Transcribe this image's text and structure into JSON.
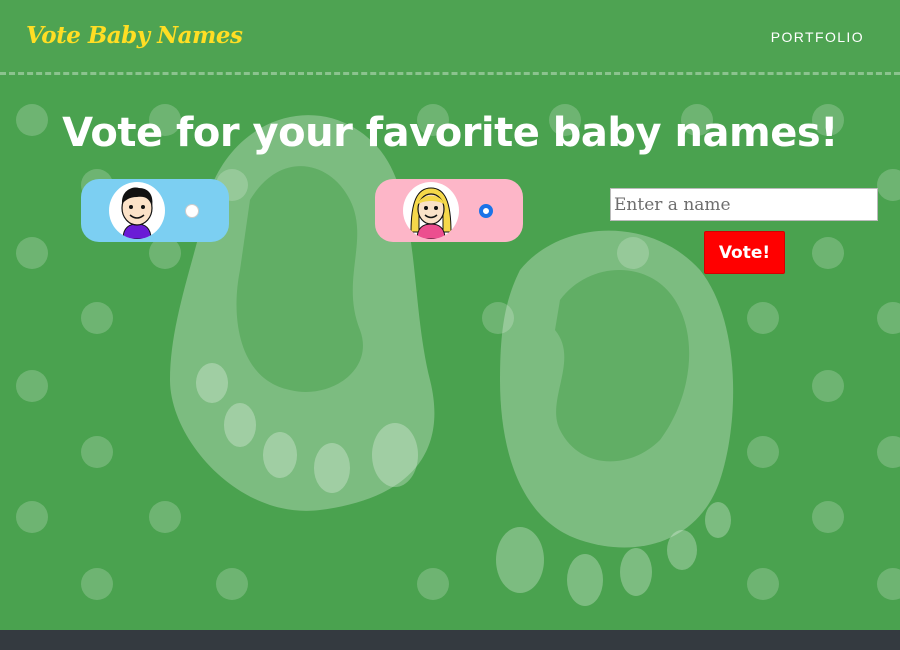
{
  "navbar": {
    "brand": "Vote Baby Names",
    "links": [
      "PORTFOLIO"
    ]
  },
  "main": {
    "headline": "Vote for your favorite baby names!",
    "options": [
      {
        "avatar": "boy-avatar",
        "selected": false,
        "color": "#7ccff2"
      },
      {
        "avatar": "girl-avatar",
        "selected": true,
        "color": "#fdb6c8"
      }
    ],
    "name_input": {
      "placeholder": "Enter a name",
      "value": ""
    },
    "vote_button": "Vote!"
  },
  "colors": {
    "background": "#4aa24f",
    "brand": "#ffde24",
    "vote_button": "#ff0000",
    "footer": "#343a40"
  }
}
